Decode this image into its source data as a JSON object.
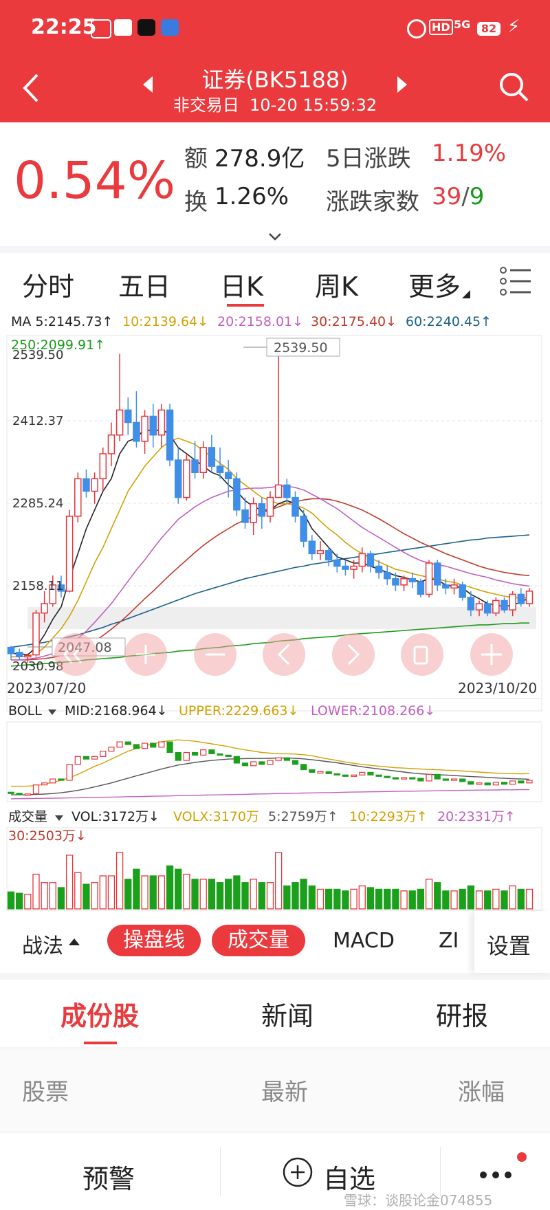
{
  "status": {
    "time": "22:25",
    "battery": "82",
    "network": "5G"
  },
  "nav": {
    "title": "证券(BK5188)",
    "subtitle": "非交易日  10-20 15:59:32"
  },
  "quote": {
    "change_pct": "0.54%",
    "amount_label": "额",
    "amount": "278.9亿",
    "turnover_label": "换",
    "turnover": "1.26%",
    "five_day_label": "5日涨跌",
    "five_day": "1.19%",
    "updown_label": "涨跌家数",
    "up_count": "39",
    "down_count": "9"
  },
  "tabs": [
    "分时",
    "五日",
    "日K",
    "周K",
    "更多"
  ],
  "active_tab": "日K",
  "ma": {
    "ma5": "MA 5:2145.73↑",
    "ma10": "10:2139.64↓",
    "ma20": "20:2158.01↓",
    "ma30": "30:2175.40↓",
    "ma60": "60:2240.45↑",
    "ma250": "250:2099.91↑"
  },
  "kline": {
    "y_ticks": [
      "2539.50",
      "2412.37",
      "2285.24",
      "2158.11",
      "2030.98"
    ],
    "high_label": "2539.50",
    "low_label": "2047.08",
    "date_start": "2023/07/20",
    "date_end": "2023/10/20"
  },
  "boll": {
    "label": "BOLL",
    "mid": "MID:2168.964↓",
    "upper": "UPPER:2229.663↓",
    "lower": "LOWER:2108.266↓"
  },
  "volume": {
    "label": "成交量",
    "vol": "VOL:3172万↓",
    "volx": "VOLX:3170万",
    "v5": "5:2759万↑",
    "v10": "10:2293万↑",
    "v20": "20:2331万↑",
    "v30": "30:2503万↓"
  },
  "toolbar": {
    "zhanfa": "战法",
    "caopan": "操盘线",
    "chengjiao": "成交量",
    "macd": "MACD",
    "zi": "ZI",
    "settings": "设置"
  },
  "subtabs": [
    "成份股",
    "新闻",
    "研报"
  ],
  "list_header": [
    "股票",
    "最新",
    "涨幅"
  ],
  "bottom": {
    "alert": "预警",
    "add": "自选",
    "watermark": "雪球：谈股论金074855"
  },
  "colors": {
    "red": "#ea3a3d",
    "up": "#e8343a",
    "down_candle": "#3f8ee8",
    "vol_down": "#1aa01a"
  },
  "chart_data": {
    "type": "candlestick",
    "x_range": [
      "2023/07/20",
      "2023/10/20"
    ],
    "ylim": [
      2030.98,
      2539.5
    ],
    "ohlc": [
      [
        2060,
        2062,
        2040,
        2050
      ],
      [
        2052,
        2058,
        2040,
        2045
      ],
      [
        2045,
        2050,
        2035,
        2047
      ],
      [
        2048,
        2120,
        2045,
        2115
      ],
      [
        2115,
        2150,
        2100,
        2130
      ],
      [
        2130,
        2175,
        2125,
        2160
      ],
      [
        2160,
        2175,
        2140,
        2150
      ],
      [
        2150,
        2280,
        2148,
        2270
      ],
      [
        2270,
        2340,
        2260,
        2330
      ],
      [
        2330,
        2345,
        2300,
        2310
      ],
      [
        2310,
        2340,
        2290,
        2330
      ],
      [
        2330,
        2380,
        2310,
        2370
      ],
      [
        2370,
        2420,
        2350,
        2400
      ],
      [
        2400,
        2530,
        2390,
        2440
      ],
      [
        2440,
        2460,
        2400,
        2420
      ],
      [
        2420,
        2470,
        2380,
        2390
      ],
      [
        2390,
        2440,
        2370,
        2430
      ],
      [
        2430,
        2450,
        2380,
        2400
      ],
      [
        2400,
        2450,
        2380,
        2440
      ],
      [
        2440,
        2450,
        2350,
        2360
      ],
      [
        2360,
        2380,
        2290,
        2300
      ],
      [
        2300,
        2370,
        2295,
        2360
      ],
      [
        2360,
        2390,
        2330,
        2340
      ],
      [
        2340,
        2390,
        2330,
        2380
      ],
      [
        2380,
        2400,
        2340,
        2350
      ],
      [
        2350,
        2380,
        2330,
        2340
      ],
      [
        2340,
        2360,
        2300,
        2330
      ],
      [
        2330,
        2340,
        2270,
        2280
      ],
      [
        2280,
        2300,
        2250,
        2260
      ],
      [
        2260,
        2300,
        2240,
        2290
      ],
      [
        2290,
        2300,
        2250,
        2270
      ],
      [
        2270,
        2310,
        2260,
        2300
      ],
      [
        2300,
        2539,
        2300,
        2320
      ],
      [
        2320,
        2330,
        2290,
        2300
      ],
      [
        2300,
        2310,
        2260,
        2270
      ],
      [
        2270,
        2280,
        2220,
        2230
      ],
      [
        2230,
        2240,
        2200,
        2210
      ],
      [
        2210,
        2230,
        2200,
        2215
      ],
      [
        2215,
        2220,
        2190,
        2200
      ],
      [
        2200,
        2210,
        2180,
        2190
      ],
      [
        2190,
        2200,
        2175,
        2185
      ],
      [
        2185,
        2200,
        2170,
        2190
      ],
      [
        2190,
        2220,
        2180,
        2210
      ],
      [
        2210,
        2215,
        2180,
        2190
      ],
      [
        2190,
        2200,
        2170,
        2180
      ],
      [
        2180,
        2190,
        2160,
        2170
      ],
      [
        2170,
        2180,
        2150,
        2160
      ],
      [
        2160,
        2175,
        2150,
        2170
      ],
      [
        2170,
        2180,
        2155,
        2165
      ],
      [
        2165,
        2170,
        2140,
        2145
      ],
      [
        2145,
        2200,
        2140,
        2195
      ],
      [
        2195,
        2200,
        2150,
        2160
      ],
      [
        2160,
        2170,
        2145,
        2155
      ],
      [
        2155,
        2170,
        2145,
        2160
      ],
      [
        2160,
        2165,
        2135,
        2140
      ],
      [
        2140,
        2150,
        2110,
        2120
      ],
      [
        2120,
        2135,
        2110,
        2130
      ],
      [
        2130,
        2135,
        2110,
        2115
      ],
      [
        2115,
        2140,
        2110,
        2135
      ],
      [
        2135,
        2140,
        2115,
        2120
      ],
      [
        2120,
        2150,
        2110,
        2145
      ],
      [
        2145,
        2155,
        2125,
        2130
      ],
      [
        2130,
        2155,
        2125,
        2150
      ]
    ],
    "ma5": [
      2050,
      2050,
      2048,
      2060,
      2080,
      2105,
      2125,
      2170,
      2210,
      2250,
      2280,
      2310,
      2330,
      2370,
      2390,
      2395,
      2410,
      2405,
      2410,
      2400,
      2380,
      2370,
      2360,
      2350,
      2340,
      2335,
      2320,
      2310,
      2295,
      2285,
      2280,
      2280,
      2290,
      2295,
      2290,
      2275,
      2250,
      2235,
      2220,
      2205,
      2200,
      2195,
      2195,
      2190,
      2185,
      2180,
      2175,
      2172,
      2168,
      2165,
      2170,
      2168,
      2160,
      2158,
      2155,
      2145,
      2138,
      2130,
      2128,
      2125,
      2128,
      2132,
      2140
    ],
    "ma10": [
      2045,
      2045,
      2046,
      2050,
      2060,
      2075,
      2090,
      2110,
      2135,
      2165,
      2195,
      2220,
      2250,
      2280,
      2310,
      2330,
      2350,
      2365,
      2380,
      2390,
      2395,
      2390,
      2385,
      2375,
      2365,
      2355,
      2345,
      2330,
      2320,
      2310,
      2300,
      2295,
      2290,
      2290,
      2288,
      2283,
      2275,
      2262,
      2250,
      2240,
      2228,
      2218,
      2210,
      2203,
      2197,
      2191,
      2185,
      2182,
      2178,
      2175,
      2172,
      2170,
      2166,
      2164,
      2160,
      2156,
      2152,
      2148,
      2145,
      2142,
      2140,
      2139,
      2140
    ],
    "ma20": [
      2040,
      2040,
      2041,
      2043,
      2046,
      2050,
      2056,
      2064,
      2074,
      2086,
      2100,
      2115,
      2130,
      2148,
      2166,
      2184,
      2200,
      2218,
      2235,
      2250,
      2265,
      2275,
      2285,
      2293,
      2300,
      2305,
      2310,
      2312,
      2314,
      2315,
      2315,
      2316,
      2318,
      2318,
      2316,
      2312,
      2305,
      2298,
      2290,
      2282,
      2272,
      2262,
      2252,
      2244,
      2236,
      2228,
      2220,
      2212,
      2205,
      2199,
      2195,
      2192,
      2190,
      2186,
      2182,
      2178,
      2175,
      2172,
      2168,
      2165,
      2162,
      2160,
      2158
    ],
    "ma30": [
      2040,
      2040,
      2040,
      2041,
      2042,
      2044,
      2047,
      2051,
      2056,
      2062,
      2070,
      2079,
      2089,
      2100,
      2112,
      2125,
      2138,
      2150,
      2163,
      2176,
      2188,
      2200,
      2212,
      2223,
      2233,
      2242,
      2250,
      2258,
      2264,
      2270,
      2275,
      2280,
      2285,
      2290,
      2293,
      2296,
      2298,
      2298,
      2297,
      2294,
      2290,
      2285,
      2280,
      2273,
      2266,
      2258,
      2250,
      2242,
      2235,
      2228,
      2222,
      2216,
      2210,
      2205,
      2200,
      2195,
      2190,
      2186,
      2183,
      2180,
      2178,
      2176,
      2175
    ],
    "ma60": [
      2060,
      2062,
      2064,
      2066,
      2068,
      2071,
      2074,
      2077,
      2080,
      2084,
      2088,
      2092,
      2097,
      2101,
      2106,
      2111,
      2116,
      2121,
      2126,
      2131,
      2136,
      2141,
      2146,
      2150,
      2154,
      2158,
      2162,
      2166,
      2170,
      2173,
      2176,
      2179,
      2182,
      2185,
      2188,
      2190,
      2193,
      2195,
      2197,
      2200,
      2202,
      2204,
      2206,
      2208,
      2210,
      2212,
      2214,
      2216,
      2218,
      2220,
      2222,
      2224,
      2226,
      2228,
      2230,
      2232,
      2233,
      2235,
      2236,
      2237,
      2238,
      2239,
      2240
    ],
    "ma250": [
      2030,
      2031,
      2032,
      2033,
      2034,
      2035,
      2036,
      2037,
      2038,
      2040,
      2041,
      2042,
      2043,
      2044,
      2046,
      2047,
      2048,
      2050,
      2051,
      2052,
      2054,
      2055,
      2056,
      2058,
      2059,
      2060,
      2062,
      2063,
      2064,
      2066,
      2067,
      2068,
      2070,
      2071,
      2072,
      2074,
      2075,
      2076,
      2077,
      2078,
      2080,
      2081,
      2082,
      2083,
      2084,
      2085,
      2086,
      2087,
      2088,
      2089,
      2090,
      2091,
      2092,
      2093,
      2094,
      2095,
      2096,
      2096,
      2097,
      2098,
      2098,
      2099,
      2099
    ]
  }
}
